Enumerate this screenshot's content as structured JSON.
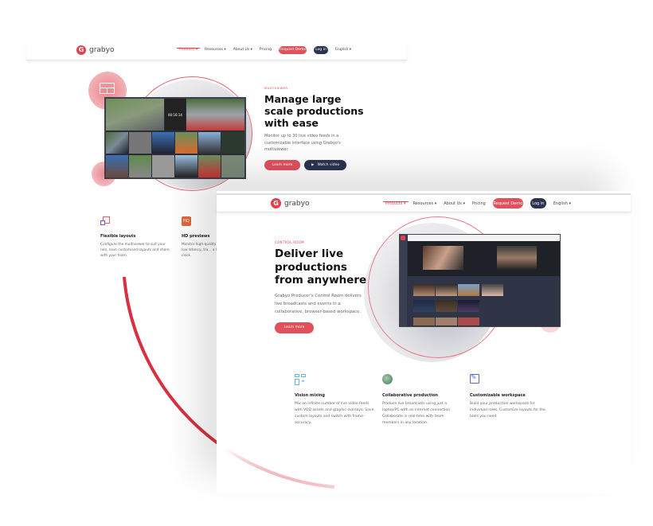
{
  "back_page": {
    "logo": "grabyo",
    "nav": {
      "items": [
        "Products",
        "Resources",
        "About Us",
        "Pricing"
      ],
      "request_demo": "Request Demo",
      "login": "Log in",
      "language": "English"
    },
    "hero": {
      "tag": "MULTIVIEWER",
      "title": "Manage large scale productions with ease",
      "description": "Monitor up to 30 live video feeds in a customizable interface using Grabyo's multiviewer.",
      "learn_more": "Learn more",
      "watch_video": "Watch video",
      "timer": "00:16:14"
    },
    "features": [
      {
        "icon": "layout-icon",
        "title": "Flexible layouts",
        "text": "Configure the multiviewer to suit your role, save customised layouts and share with your team."
      },
      {
        "icon": "hq-icon",
        "badge": "HQ",
        "title": "HD previews",
        "text": "Monitor high-quality ultra-low latency, tra... a live clock."
      }
    ]
  },
  "front_page": {
    "logo": "grabyo",
    "nav": {
      "items": [
        "Products",
        "Resources",
        "About Us",
        "Pricing"
      ],
      "request_demo": "Request Demo",
      "login": "Log in",
      "language": "English"
    },
    "hero": {
      "tag": "CONTROL ROOM",
      "title": "Deliver live productions from anywhere",
      "description": "Grabyo Producer's Control Room delivers live broadcasts and events in a collaborative, browser-based workspace.",
      "learn_more": "Learn more"
    },
    "features": [
      {
        "icon": "vision-mixing-icon",
        "title": "Vision mixing",
        "text": "Mix an infinite number of live video feeds with VOD assets and graphic overlays. Save custom layouts and switch with frame-accuracy."
      },
      {
        "icon": "globe-icon",
        "title": "Collaborative production",
        "text": "Produce live broadcasts using just a laptop/PC with an internet connection. Collaborate in real-time with team members in any location."
      },
      {
        "icon": "edit-icon",
        "title": "Customizable workspace",
        "text": "Build your production workspace for individual roles. Customize layouts for the tools you need."
      }
    ]
  },
  "colors": {
    "brand_red": "#e0434f",
    "navy": "#2c3350"
  }
}
